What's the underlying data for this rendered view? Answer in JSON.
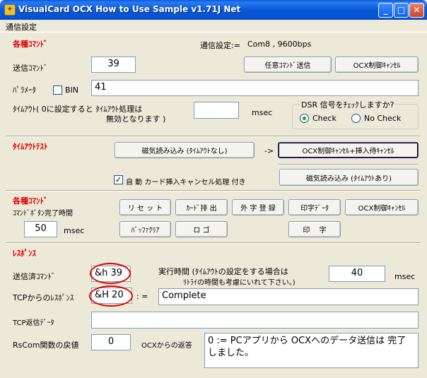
{
  "window": {
    "title": "VisualCard OCX How to Use Sample v1.71J Net"
  },
  "menu": {
    "settings": "通信設定"
  },
  "commands": {
    "section_title": "各種ｺﾏﾝﾄﾞ",
    "comm_settings_label": "通信設定:=",
    "comm_settings_value": "Com8 , 9600bps",
    "send_label": "送信ｺﾏﾝﾄﾞ",
    "send_value": "39",
    "send_any_button": "任意ｺﾏﾝﾄﾞ送信",
    "ocx_cancel_button": "OCX制御ｷｬﾝｾﾙ",
    "param_label": "ﾊﾟﾗﾒｰﾀ",
    "bin_label": "BIN",
    "param_value": "41",
    "timeout_label_1": "ﾀｲﾑｱｳﾄ( 0に設定すると ﾀｲﾑｱｳﾄ処理は",
    "timeout_label_2": "無効となります )",
    "timeout_value": "",
    "msec": "msec",
    "dsr_group_title": "DSR 信号をﾁｪｯｸしますか?",
    "dsr_check": "Check",
    "dsr_nocheck": "No Check"
  },
  "timeout_test": {
    "section_title": "ﾀｲﾑｱｳﾄﾃｽﾄ",
    "mag_read_no_timeout": "磁気読み込み (ﾀｲﾑｱｳﾄなし)",
    "arrow": "->",
    "ocx_cancel_insert_wait": "OCX制御ｷｬﾝｾﾙ+挿入待ｷｬﾝｾﾙ",
    "auto_cancel_label": "自 動 カード挿入キャンセル処理 付き",
    "mag_read_timeout": "磁気読み込み (ﾀｲﾑｱｳﾄあり)"
  },
  "commands2": {
    "section_title": "各種ｺﾏﾝﾄﾞ",
    "complete_time_label": "ｺﾏﾝﾄﾞﾎﾞﾀﾝ完了時間",
    "complete_time_value": "50",
    "msec": "msec",
    "reset": "リ セ ッ ト",
    "card_eject": "ｶｰﾄﾞ排 出",
    "external_char": "外 字 登 録",
    "print_data": "印字ﾃﾞｰﾀ",
    "ocx_cancel": "OCX制御ｷｬﾝｾﾙ",
    "buffer_clear": "ﾊﾞｯﾌｧｸﾘｱ",
    "logo": "ロ ゴ",
    "print": "印　 字"
  },
  "response": {
    "section_title": "ﾚｽﾎﾟﾝｽ",
    "sent_cmd_label": "送信済ｺﾏﾝﾄﾞ",
    "sent_cmd_value": "&h 39",
    "exec_time_label_1": "実行時間 (ﾀｲﾑｱｳﾄの設定をする場合は",
    "exec_time_label_2": "ﾘﾄﾗｲの時間も考慮にいれて下さい。)",
    "exec_time_value": "40",
    "msec": "msec",
    "tcp_response_label": "TCPからのﾚｽﾎﾟﾝｽ",
    "tcp_response_value": "&H 20",
    "assign": ": =",
    "tcp_response_text": "Complete",
    "tcp_return_label": "TCP返信ﾃﾞｰﾀ",
    "tcp_return_value": "",
    "rscom_label": "RsCom関数の戻値",
    "rscom_value": "0",
    "ocx_return_label": "OCXからの返答",
    "ocx_return_text": "0 := PCアプリから OCXへのデータ送信は 完了しました。"
  }
}
